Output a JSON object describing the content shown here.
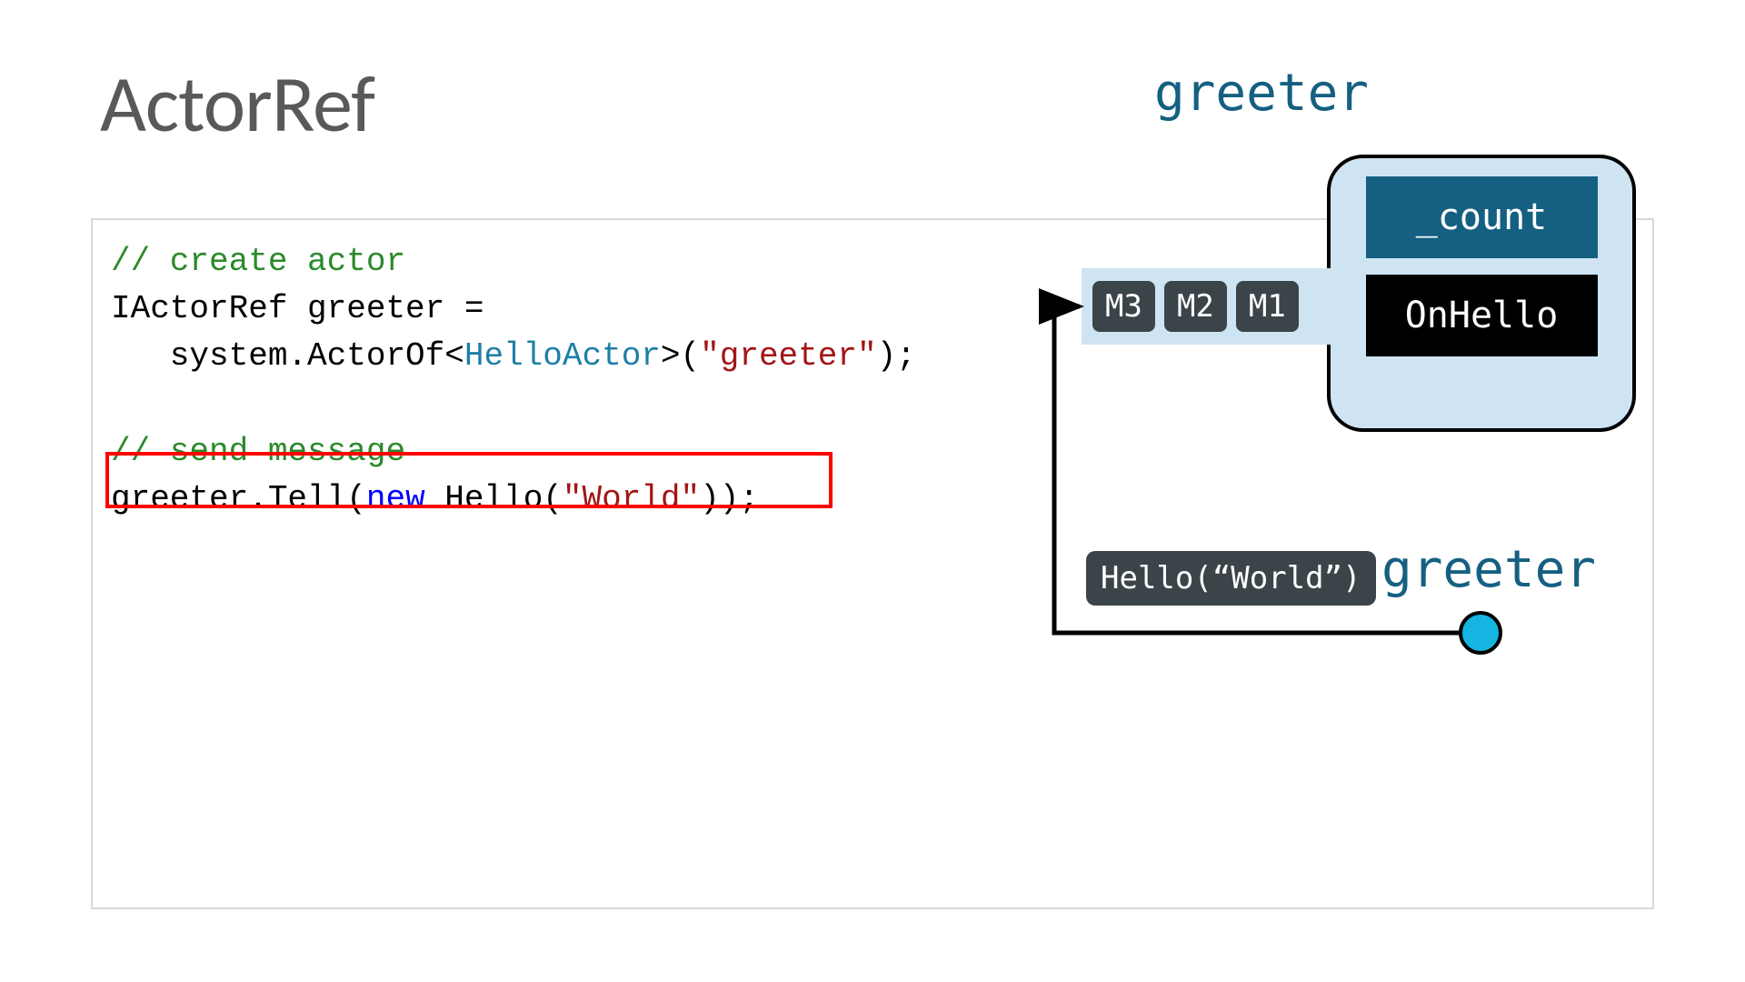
{
  "title": "ActorRef",
  "code": {
    "comment_create": "// create actor",
    "line2_a": "IActorRef greeter =",
    "line3_a": "   system.ActorOf<",
    "line3_type": "HelloActor",
    "line3_b": ">(",
    "line3_str": "\"greeter\"",
    "line3_c": ");",
    "comment_send": "// send message",
    "line5_a": "greeter.Tell(",
    "line5_kw": "new",
    "line5_b": " Hello(",
    "line5_str": "\"World\"",
    "line5_c": "));"
  },
  "diagram": {
    "top_label": "greeter",
    "actor": {
      "count": "_count",
      "onhello": "OnHello"
    },
    "queue": {
      "m3": "M3",
      "m2": "M2",
      "m1": "M1"
    },
    "hello_msg": "Hello(“World”)",
    "ref_label": "greeter"
  }
}
